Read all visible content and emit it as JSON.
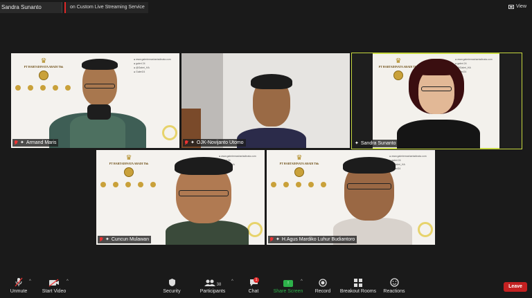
{
  "topbar": {
    "host_name": "Sandra Sunanto",
    "stream_label": "on Custom Live Streaming Service",
    "view_label": "View"
  },
  "background": {
    "company": "PT HARTADINATA ABADI Tbk",
    "social_lines": [
      "www.galeriemashartadinata.com",
      "galeri 24",
      "@Galeri_HA",
      "Galeri24"
    ]
  },
  "participants": [
    {
      "name": "Armand Maris",
      "muted": true,
      "active": false
    },
    {
      "name": "OJK-Novijanto Utomo",
      "muted": true,
      "active": false
    },
    {
      "name": "Sandra Sunanto",
      "muted": false,
      "active": true
    },
    {
      "name": "Cuncun Mulawan",
      "muted": true,
      "active": false
    },
    {
      "name": "H.Agus Mardiko Luhur Budiantoro",
      "muted": true,
      "active": false
    }
  ],
  "toolbar": {
    "unmute": "Unmute",
    "start_video": "Start Video",
    "security": "Security",
    "participants": "Participants",
    "participants_count": "38",
    "chat": "Chat",
    "chat_badge": "1",
    "share_screen": "Share Screen",
    "record": "Record",
    "breakout_rooms": "Breakout Rooms",
    "reactions": "Reactions",
    "leave": "Leave"
  },
  "colors": {
    "active_speaker_border": "#c7d93f",
    "share_green": "#2db14a",
    "leave_red": "#c42121",
    "muted_red": "#e33333"
  },
  "icons": [
    "microphone-muted-icon",
    "video-off-icon",
    "shield-icon",
    "people-icon",
    "chat-icon",
    "share-screen-icon",
    "record-icon",
    "grid-icon",
    "smiley-icon",
    "pin-icon"
  ]
}
